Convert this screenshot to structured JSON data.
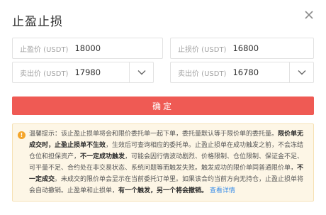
{
  "dialog": {
    "title": "止盈止损"
  },
  "fields": {
    "take_profit_trigger": {
      "label": "止盈价 (USDT)",
      "value": "18000"
    },
    "stop_loss_trigger": {
      "label": "止损价 (USDT)",
      "value": "16800"
    },
    "take_profit_sell": {
      "label": "卖出价 (USDT)",
      "value": "17980"
    },
    "stop_loss_sell": {
      "label": "卖出价 (USDT)",
      "value": "16780"
    }
  },
  "confirm_label": "确定",
  "notice": {
    "icon": "!",
    "t1": "温馨提示：该止盈止损单将会和限价委托单一起下单，委托量默认等于限价单的委托量。",
    "b1": "限价单无成交时，止盈止损单不生效",
    "t2": "，生效后可查询相应的委托单。止盈止损单在成功触发之前，不会冻结仓位和担保资产，",
    "b2": "不一定成功触发",
    "t3": "，可能会因行情波动剧烈、价格限制、仓位限制、保证金不足、可平量不足、合约处在非交易状态、系统问题等而触发失败。触发成功的限价单同普通限价单，",
    "b3": "不一定成交",
    "t4": "。未成交的限价单会显示在当前委托订单里。如果该合约当前方向无持仓，止盈止损单将会自动撤销。止盈单和止损单，",
    "b4": "有一个触发，另一个将会撤销。",
    "link": "查看详情"
  },
  "colors": {
    "confirm_bg": "#ef5a54",
    "notice_bg": "#fdf6e6",
    "warn_icon": "#f4a52a",
    "link": "#3b8ee8"
  },
  "icons": {
    "close": "close-icon",
    "dropdown": "chevron-down-icon",
    "warning": "warning-icon"
  }
}
